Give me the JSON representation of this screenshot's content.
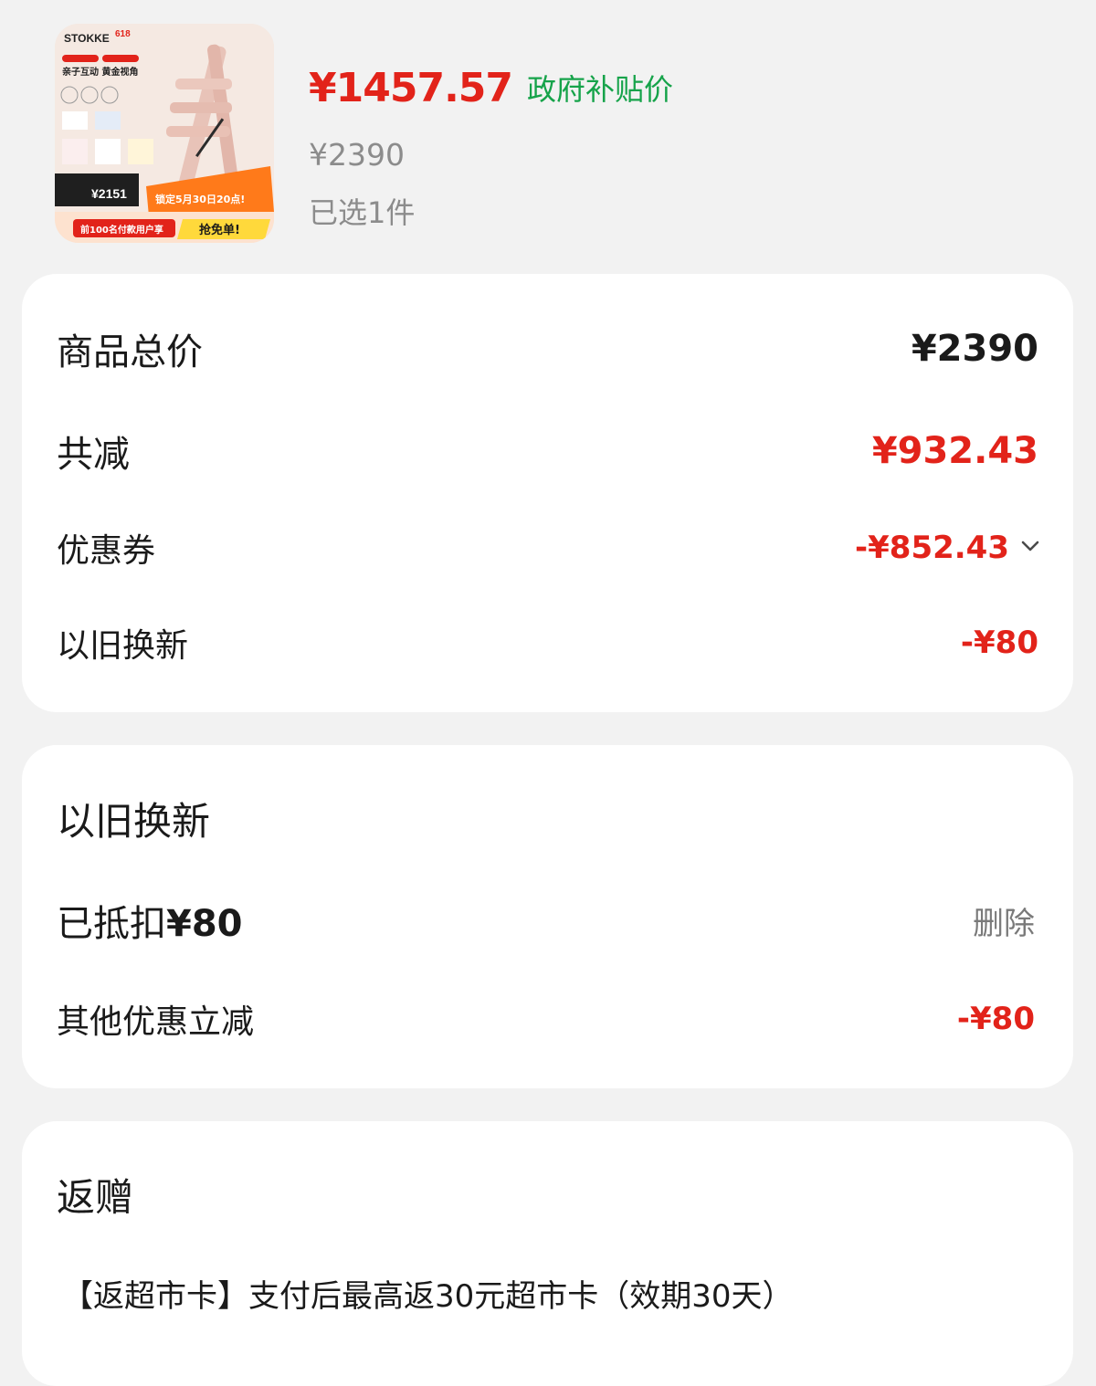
{
  "product": {
    "image_alt": "STOKKE Tripp Trapp high chair promotional image",
    "image_text": {
      "brand": "STOKKE",
      "badge": "618",
      "headline": "亲子互动 黄金视角",
      "price_label": "¥2151",
      "promo_banner": "锁定5月30日20点!",
      "promo_sub": "前100名付款用户享",
      "free_order": "抢免单!"
    },
    "sale_price": "¥1457.57",
    "subsidy_tag": "政府补贴价",
    "original_price": "¥2390",
    "selected_qty": "已选1件"
  },
  "summary": {
    "total_label": "商品总价",
    "total_value": "¥2390",
    "reduced_label": "共减",
    "reduced_value": "¥932.43",
    "coupon_label": "优惠券",
    "coupon_value": "-¥852.43",
    "tradein_label": "以旧换新",
    "tradein_value": "-¥80"
  },
  "tradein": {
    "title": "以旧换新",
    "deducted_prefix": "已抵扣",
    "deducted_amount": "¥80",
    "delete_label": "删除",
    "other_label": "其他优惠立减",
    "other_value": "-¥80"
  },
  "rebate": {
    "title": "返赠",
    "text": "【返超市卡】支付后最高返30元超市卡（效期30天）"
  },
  "colors": {
    "accent_red": "#e2231a",
    "subsidy_green": "#16a34a",
    "muted_gray": "#8c8c8c",
    "background": "#f2f2f2",
    "card": "#ffffff"
  },
  "icons": {
    "coupon_expand": "chevron-down-icon"
  }
}
